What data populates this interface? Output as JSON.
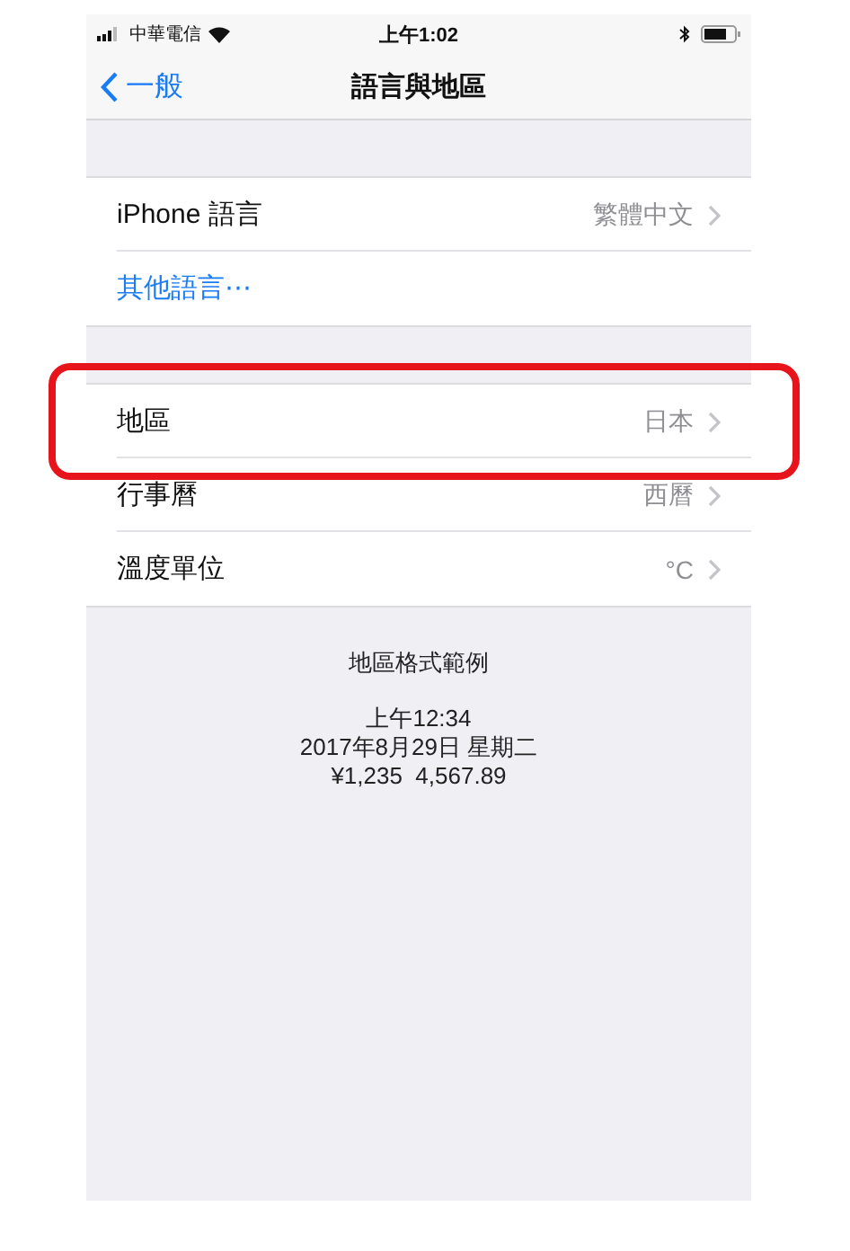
{
  "status_bar": {
    "carrier": "中華電信",
    "time": "上午1:02"
  },
  "nav": {
    "back": "一般",
    "title": "語言與地區"
  },
  "groups": [
    {
      "rows": [
        {
          "kind": "value",
          "label": "iPhone 語言",
          "value": "繁體中文",
          "highlighted": false
        },
        {
          "kind": "link",
          "label": "其他語言⋯"
        }
      ]
    },
    {
      "rows": [
        {
          "kind": "value",
          "label": "地區",
          "value": "日本",
          "highlighted": true
        },
        {
          "kind": "value",
          "label": "行事曆",
          "value": "西曆",
          "highlighted": false
        },
        {
          "kind": "value",
          "label": "溫度單位",
          "value": "°C",
          "highlighted": false
        }
      ]
    }
  ],
  "format_example": {
    "title": "地區格式範例",
    "lines": [
      "上午12:34",
      "2017年8月29日 星期二",
      "¥1,235  4,567.89"
    ]
  }
}
